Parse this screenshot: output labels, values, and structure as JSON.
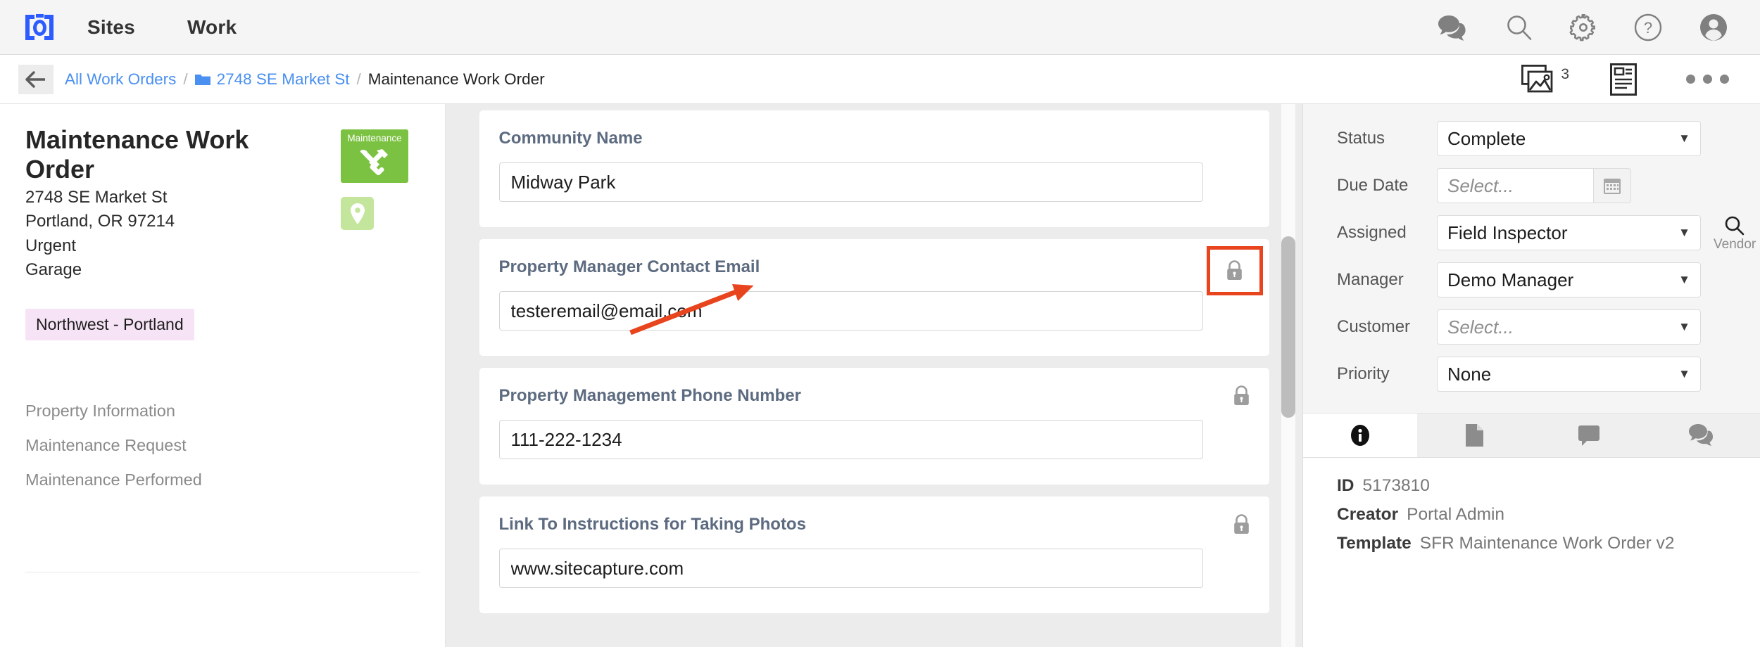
{
  "topnav": {
    "logo_name": "sitecapture-logo-icon",
    "links": [
      {
        "label": "Sites"
      },
      {
        "label": "Work"
      }
    ],
    "icons": [
      {
        "name": "chat-bubbles-icon"
      },
      {
        "name": "search-icon"
      },
      {
        "name": "gear-icon"
      },
      {
        "name": "help-icon"
      },
      {
        "name": "avatar-icon"
      }
    ]
  },
  "breadcrumb": {
    "back_label": "back-arrow-icon",
    "items": [
      {
        "label": "All Work Orders",
        "type": "link"
      },
      {
        "label": "2748 SE Market St",
        "type": "link",
        "icon": "folder-icon"
      },
      {
        "label": "Maintenance Work Order",
        "type": "current"
      }
    ],
    "separator": "/",
    "photos_count": "3",
    "photos_icon": "photos-icon",
    "report_icon": "report-document-icon",
    "overflow_icon": "more-options-icon"
  },
  "left_panel": {
    "title": "Maintenance Work Order",
    "address_line1": "2748 SE Market St",
    "address_line2": "Portland, OR 97214",
    "urgency": "Urgent",
    "location": "Garage",
    "type_badge": {
      "label": "Maintenance",
      "icon": "wrench-hammer-icon",
      "color": "#7cc242"
    },
    "map_pin": {
      "icon": "map-pin-icon",
      "color": "#c3e59c"
    },
    "region_tag": {
      "label": "Northwest - Portland",
      "bg": "#f6e4f6"
    },
    "nav_items": [
      {
        "label": "Property Information"
      },
      {
        "label": "Maintenance Request"
      },
      {
        "label": "Maintenance Performed"
      }
    ]
  },
  "form": {
    "cards": [
      {
        "label": "Community Name",
        "value": "Midway Park",
        "locked": false,
        "highlighted": false
      },
      {
        "label": "Property Manager Contact Email",
        "value": "testeremail@email.com",
        "locked": true,
        "lock_icon": "lock-icon",
        "highlighted": true,
        "highlight_color": "#e8441d"
      },
      {
        "label": "Property Management Phone Number",
        "value": "111-222-1234",
        "locked": true,
        "lock_icon": "lock-icon",
        "highlighted": false
      },
      {
        "label": "Link To Instructions for Taking Photos",
        "value": "www.sitecapture.com",
        "locked": true,
        "lock_icon": "lock-icon",
        "highlighted": false
      }
    ]
  },
  "sidebar": {
    "fields": [
      {
        "label": "Status",
        "value": "Complete",
        "placeholder": false,
        "control": "select"
      },
      {
        "label": "Due Date",
        "value": "Select...",
        "placeholder": true,
        "control": "date"
      },
      {
        "label": "Assigned",
        "value": "Field Inspector",
        "placeholder": false,
        "control": "select"
      },
      {
        "label": "Manager",
        "value": "Demo Manager",
        "placeholder": false,
        "control": "select"
      },
      {
        "label": "Customer",
        "value": "Select...",
        "placeholder": true,
        "control": "select"
      },
      {
        "label": "Priority",
        "value": "None",
        "placeholder": false,
        "control": "select"
      }
    ],
    "vendor_button": {
      "label": "Vendor",
      "icon": "search-icon"
    },
    "calendar_icon": "calendar-icon",
    "tabs": [
      {
        "name": "info-tab",
        "icon": "info-icon",
        "active": true
      },
      {
        "name": "documents-tab",
        "icon": "document-icon",
        "active": false
      },
      {
        "name": "notes-tab",
        "icon": "chat-bubble-icon",
        "active": false
      },
      {
        "name": "comments-tab",
        "icon": "chat-bubbles-icon",
        "active": false
      }
    ],
    "info": [
      {
        "key": "ID",
        "value": "5173810"
      },
      {
        "key": "Creator",
        "value": "Portal Admin"
      },
      {
        "key": "Template",
        "value": "SFR Maintenance Work Order v2"
      }
    ]
  }
}
